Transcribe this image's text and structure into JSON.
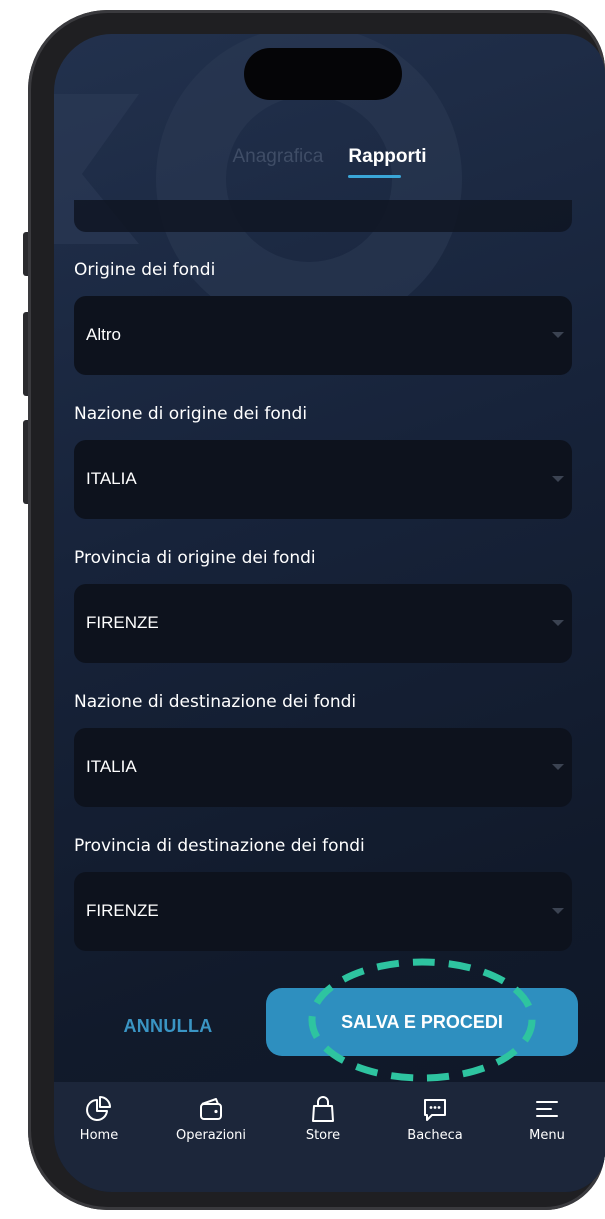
{
  "tabs": [
    {
      "label": "Anagrafica",
      "active": false
    },
    {
      "label": "Rapporti",
      "active": true
    }
  ],
  "fields": [
    {
      "label": "Origine dei fondi",
      "value": "Altro"
    },
    {
      "label": "Nazione di origine dei fondi",
      "value": "ITALIA"
    },
    {
      "label": "Provincia di origine dei fondi",
      "value": "FIRENZE"
    },
    {
      "label": "Nazione di destinazione dei fondi",
      "value": "ITALIA"
    },
    {
      "label": "Provincia di destinazione dei fondi",
      "value": "FIRENZE"
    }
  ],
  "actions": {
    "cancel_label": "ANNULLA",
    "save_label": "SALVA E PROCEDI"
  },
  "nav": [
    {
      "label": "Home",
      "icon": "pie-chart-icon"
    },
    {
      "label": "Operazioni",
      "icon": "wallet-icon"
    },
    {
      "label": "Store",
      "icon": "shopping-bag-icon"
    },
    {
      "label": "Bacheca",
      "icon": "chat-bubble-icon"
    },
    {
      "label": "Menu",
      "icon": "menu-icon"
    }
  ],
  "colors": {
    "accent": "#2e8fbf",
    "highlight": "#2ec4a0",
    "background": "#17233a",
    "nav_background": "#1c263a"
  }
}
